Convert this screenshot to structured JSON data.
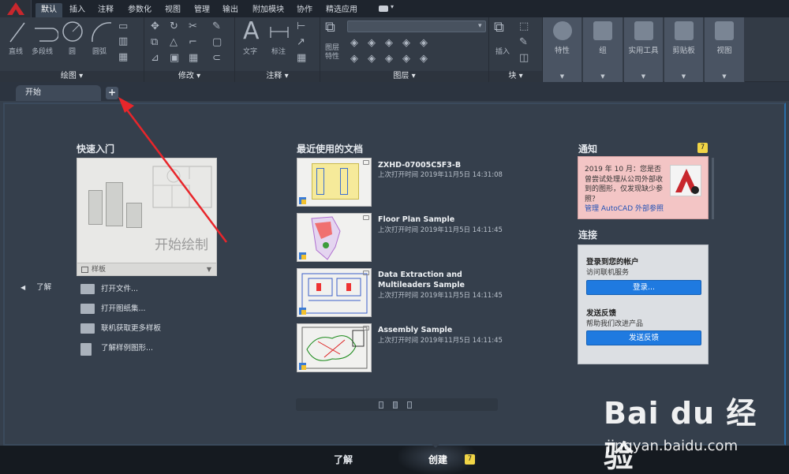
{
  "menu": {
    "tabs": [
      "默认",
      "插入",
      "注释",
      "参数化",
      "视图",
      "管理",
      "输出",
      "附加模块",
      "协作",
      "精选应用"
    ],
    "active_tab": "默认"
  },
  "ribbon": {
    "draw": {
      "title": "绘图 ▾",
      "tools": [
        "直线",
        "多段线",
        "圆",
        "圆弧"
      ]
    },
    "modify": {
      "title": "修改 ▾"
    },
    "annotation": {
      "title": "注释 ▾",
      "tools": [
        "文字",
        "标注"
      ]
    },
    "layers": {
      "title": "图层 ▾",
      "tools": [
        "图层\n特性"
      ]
    },
    "block": {
      "title": "块 ▾",
      "tools": [
        "插入"
      ]
    },
    "right_panels": [
      "特性",
      "组",
      "实用工具",
      "剪贴板",
      "视图"
    ]
  },
  "doc_tabs": {
    "start": "开始",
    "plus": "+"
  },
  "quick_start": {
    "title": "快速入门",
    "card_caption": "开始绘制",
    "template_label": "样板",
    "links": [
      "打开文件...",
      "打开图纸集...",
      "联机获取更多样板",
      "了解样例图形..."
    ],
    "learn_left": "了解"
  },
  "recent": {
    "title": "最近使用的文档",
    "docs": [
      {
        "name": "ZXHD-07005C5F3-B",
        "date": "上次打开时间 2019年11月5日 14:31:08"
      },
      {
        "name": "Floor Plan Sample",
        "date": "上次打开时间 2019年11月5日 14:11:45"
      },
      {
        "name": "Data Extraction and Multileaders Sample",
        "date": "上次打开时间 2019年11月5日 14:11:45"
      },
      {
        "name": "Assembly Sample",
        "date": "上次打开时间 2019年11月5日 14:11:45"
      }
    ]
  },
  "notifications": {
    "title": "通知",
    "badge": "7",
    "text": "2019 年 10 月：您是否曾尝试处理从公司外部收到的图形，仅发现缺少参照？",
    "link": "管理 AutoCAD 外部参照"
  },
  "connect": {
    "title": "连接",
    "login_title": "登录到您的帐户",
    "login_sub": "访问联机服务",
    "login_button": "登录...",
    "feedback_title": "发送反馈",
    "feedback_sub": "帮助我们改进产品",
    "feedback_button": "发送反馈"
  },
  "bottom": {
    "learn": "了解",
    "create": "创建",
    "create_badge": "7"
  },
  "watermark": {
    "brand": "Bai du 经验",
    "url": "jingyan.baidu.com"
  },
  "colors": {
    "accent": "#1f7ae0",
    "badge": "#f1d546",
    "arrow": "#e8262b"
  }
}
